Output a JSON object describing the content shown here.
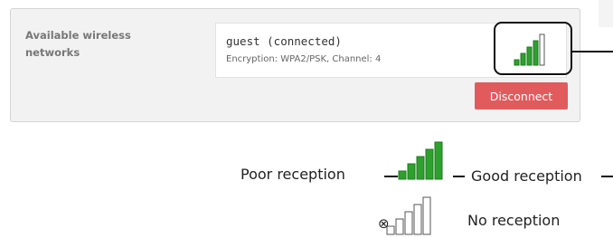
{
  "wifi": {
    "section_label": "Available wireless networks",
    "network": {
      "ssid": "guest (connected)",
      "details": "Encryption: WPA2/PSK, Channel: 4",
      "signal_bars_filled": 4,
      "signal_bars_total": 5
    },
    "disconnect_label": "Disconnect"
  },
  "legend": {
    "poor_label": "Poor reception",
    "good_label": "Good reception",
    "none_label": "No reception",
    "no_reception_symbol": "⊗"
  },
  "colors": {
    "signal_green": "#2ea02e",
    "disconnect_red": "#e15b5d",
    "panel_bg": "#f2f2f2"
  }
}
